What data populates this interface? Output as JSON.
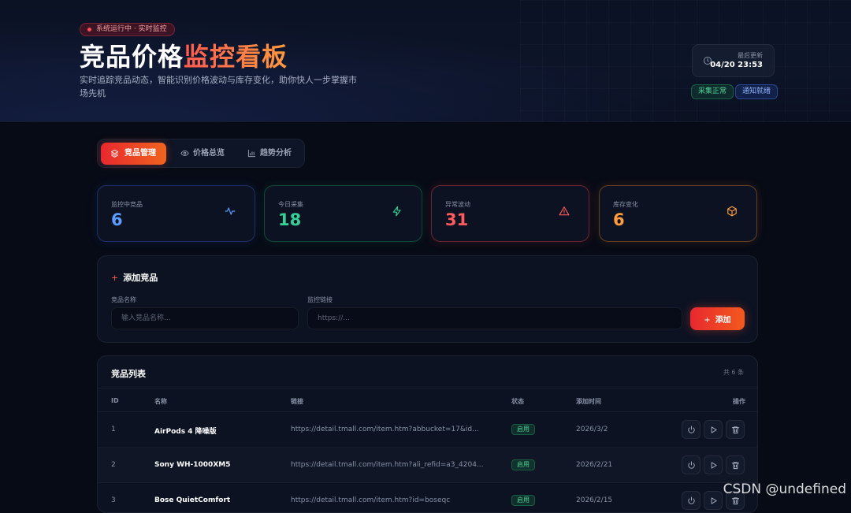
{
  "header": {
    "status_text": "系统运行中 · 实时监控",
    "title_part1": "竞品价格",
    "title_part2": "监控看板",
    "subtitle": "实时追踪竞品动态，智能识别价格波动与库存变化，助你快人一步掌握市场先机",
    "update_label": "最后更新",
    "update_time": "04/20 23:53",
    "chip_collect": "采集正常",
    "chip_notify": "通知就绪"
  },
  "tabs": [
    {
      "label": "竞品管理",
      "icon": "layers-icon",
      "active": true
    },
    {
      "label": "价格总览",
      "icon": "eye-icon",
      "active": false
    },
    {
      "label": "趋势分析",
      "icon": "bar-chart-icon",
      "active": false
    }
  ],
  "stats": [
    {
      "label": "监控中竞品",
      "value": "6",
      "icon": "activity-icon",
      "color": "#5b9dff"
    },
    {
      "label": "今日采集",
      "value": "18",
      "icon": "zap-icon",
      "color": "#33d197"
    },
    {
      "label": "异常波动",
      "value": "31",
      "icon": "alert-triangle-icon",
      "color": "#ff5b5f"
    },
    {
      "label": "库存变化",
      "value": "6",
      "icon": "box-icon",
      "color": "#ff9d3b"
    }
  ],
  "add_form": {
    "title": "添加竞品",
    "name_label": "竞品名称",
    "name_placeholder": "输入竞品名称...",
    "url_label": "监控链接",
    "url_placeholder": "https://...",
    "submit_label": "添加"
  },
  "list": {
    "title": "竞品列表",
    "count_text": "共 6 条",
    "columns": [
      "ID",
      "名称",
      "链接",
      "状态",
      "添加时间",
      "操作"
    ],
    "rows": [
      {
        "id": "1",
        "name": "AirPods 4 降噪版",
        "url": "https://detail.tmall.com/item.htm?abbucket=17&id...",
        "status": "启用",
        "date": "2026/3/2"
      },
      {
        "id": "2",
        "name": "Sony WH-1000XM5",
        "url": "https://detail.tmall.com/item.htm?ali_refid=a3_4204...",
        "status": "启用",
        "date": "2026/2/21"
      },
      {
        "id": "3",
        "name": "Bose QuietComfort",
        "url": "https://detail.tmall.com/item.htm?id=boseqc",
        "status": "启用",
        "date": "2026/2/15"
      }
    ]
  },
  "watermark": "CSDN @undefined"
}
